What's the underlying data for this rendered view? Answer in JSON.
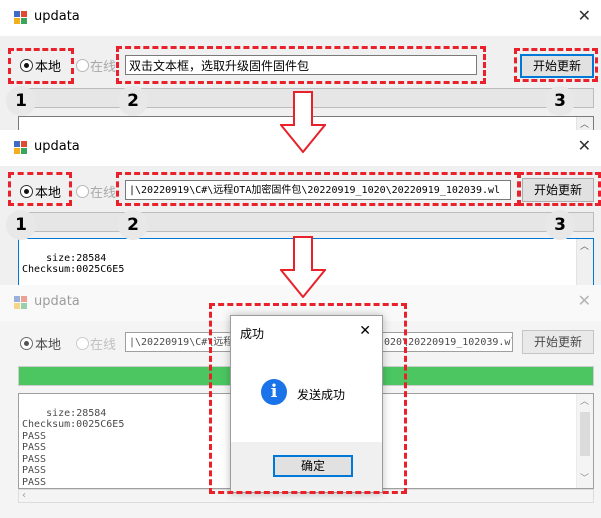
{
  "app": {
    "title": "updata",
    "close_glyph": "✕"
  },
  "radio": {
    "local_label": "本地",
    "online_label": "在线"
  },
  "step1": {
    "path_value": "双击文本框，选取升级固件固件包",
    "start_button": "开始更新",
    "markers": [
      "1",
      "2",
      "3"
    ]
  },
  "step2": {
    "path_value": "|\\20220919\\C#\\远程OTA加密固件包\\20220919_1020\\20220919_102039.wl",
    "start_button": "开始更新",
    "markers": [
      "1",
      "2",
      "3"
    ],
    "log": "size:28584\nChecksum:0025C6E5"
  },
  "step3": {
    "path_left": "|\\20220919\\C#\\远程",
    "path_right": "020\\20220919_102039.wl",
    "start_button": "开始更新",
    "progress_fraction": 1.0,
    "log": "size:28584\nChecksum:0025C6E5\nPASS\nPASS\nPASS\nPASS\nPASS\nPASS"
  },
  "dialog": {
    "title": "成功",
    "message": "发送成功",
    "ok_button": "确定",
    "icon_glyph": "i"
  },
  "colors": {
    "annotation": "#e8212a",
    "progress": "#06b025",
    "focus": "#0078d7",
    "info_icon": "#1a73e8"
  },
  "icons": [
    "app-icon",
    "close-icon",
    "info-icon",
    "down-arrow-icon",
    "scroll-arrow-icon"
  ]
}
